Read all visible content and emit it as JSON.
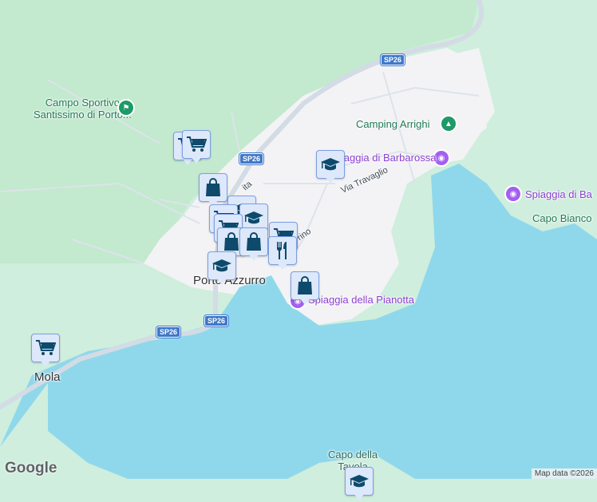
{
  "places": {
    "campo_sportivo_line1": "Campo Sportivo",
    "campo_sportivo_line2": "Santissimo di Porto...",
    "camping": "Camping Arrighi",
    "barbarossa": "Spiaggia di Barbarossa",
    "barbarossa2": "Spiaggia di Ba",
    "capo_bianco": "Capo Bianco",
    "pianotta": "Spiaggia della Pianotta",
    "porto_azzurro": "Porto Azzurro",
    "mola": "Mola",
    "capo_tavola_line1": "Capo della",
    "capo_tavola_line2": "Tavola"
  },
  "streets": {
    "travaglio": "Via Travaglio",
    "rino": "rino",
    "ita": "ita"
  },
  "road_shields": [
    "SP26",
    "SP26",
    "SP26"
  ],
  "markers": [
    "cart",
    "cart",
    "bag",
    "education",
    "education",
    "cart",
    "cart",
    "bag",
    "bag",
    "cart",
    "restaurant",
    "education",
    "bag",
    "education",
    "cart",
    "education"
  ],
  "footer": {
    "logo": "Google",
    "attribution": "Map data ©2026"
  },
  "colors": {
    "water": "#8fd8ec",
    "urban": "#f3f3f5",
    "forest": "#c3e9cf",
    "marker_bg": "#dde8fb",
    "marker_icon": "#0d4a6b"
  }
}
